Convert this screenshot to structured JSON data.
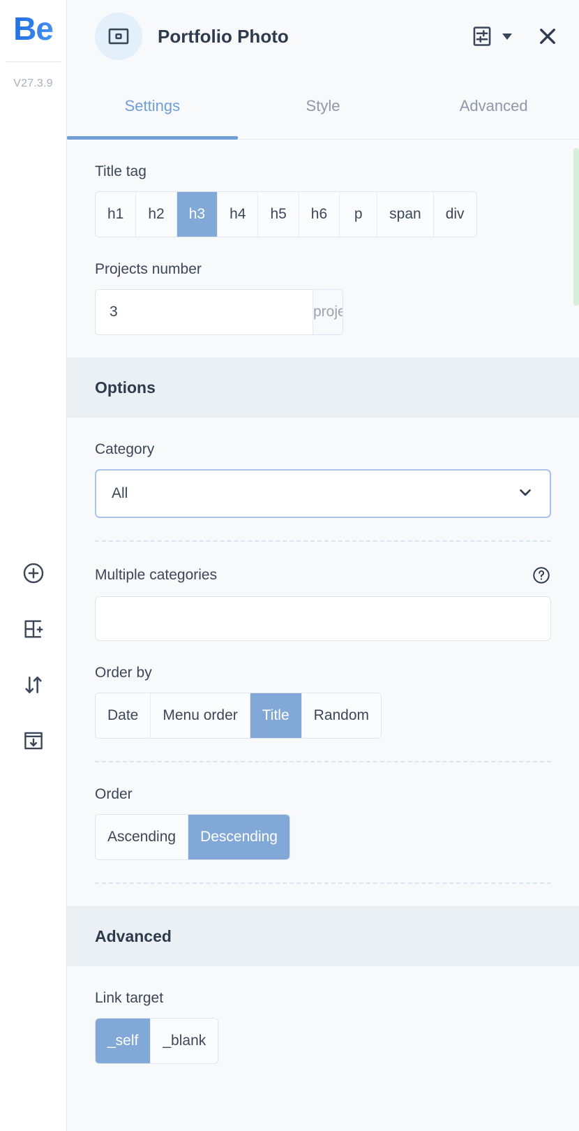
{
  "rail": {
    "logo_text": "Be",
    "version": "V27.3.9",
    "tools": [
      {
        "name": "add-circle-icon",
        "title": "Add"
      },
      {
        "name": "add-section-icon",
        "title": "Add section"
      },
      {
        "name": "sort-arrows-icon",
        "title": "Reorder"
      },
      {
        "name": "save-template-icon",
        "title": "Save template"
      }
    ]
  },
  "header": {
    "widget_icon": "image-widget-icon",
    "title": "Portfolio Photo",
    "settings_icon": "sliders-icon",
    "dropdown_icon": "caret-down-icon",
    "close_icon": "close-icon"
  },
  "tabs": [
    {
      "label": "Settings",
      "active": true
    },
    {
      "label": "Style",
      "active": false
    },
    {
      "label": "Advanced",
      "active": false
    }
  ],
  "settings": {
    "title_tag": {
      "label": "Title tag",
      "options": [
        "h1",
        "h2",
        "h3",
        "h4",
        "h5",
        "h6",
        "p",
        "span",
        "div"
      ],
      "selected": "h3"
    },
    "projects_number": {
      "label": "Projects number",
      "value": "3",
      "placeholder": "3",
      "unit": "projects"
    }
  },
  "options_section": {
    "title": "Options",
    "category": {
      "label": "Category",
      "selected": "All",
      "options": [
        "All"
      ]
    },
    "multiple_categories": {
      "label": "Multiple categories",
      "value": "",
      "placeholder": "",
      "help_icon": "help-circle-icon"
    },
    "order_by": {
      "label": "Order by",
      "options": [
        "Date",
        "Menu order",
        "Title",
        "Random"
      ],
      "selected": "Title"
    },
    "order": {
      "label": "Order",
      "options": [
        "Ascending",
        "Descending"
      ],
      "selected": "Descending"
    }
  },
  "advanced_section": {
    "title": "Advanced",
    "link_target": {
      "label": "Link target",
      "options": [
        "_self",
        "_blank"
      ],
      "selected": "_self"
    }
  },
  "colors": {
    "accent": "#82a8d8",
    "tab_active": "#6f9ed6",
    "band_bg": "#eaf0f3",
    "panel_bg": "#f7f9fb",
    "text": "#3b4758",
    "scrollbar": "#d6efda",
    "logo_blue": "#2f7ce8"
  },
  "scrollbar": {
    "name": "vertical-scrollbar"
  }
}
